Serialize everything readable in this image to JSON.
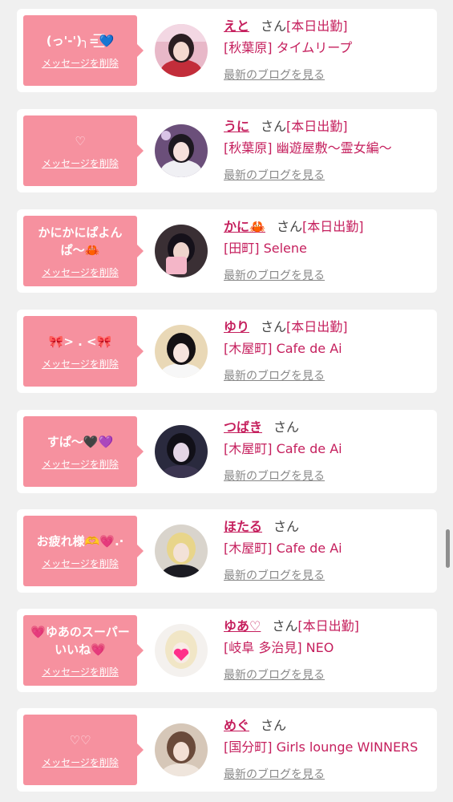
{
  "colors": {
    "accent": "#c51f5d",
    "bubble": "#f6919f"
  },
  "delete_label": "メッセージを削除",
  "san_label": "さん",
  "blog_label": "最新のブログを見る",
  "cards": [
    {
      "message": "(っ'-')╮=͟͟͞͞💙",
      "faint": false,
      "name": "えと",
      "status": "[本日出勤]",
      "shop": "[秋葉原] タイムリープ"
    },
    {
      "message": "♡",
      "faint": true,
      "name": "うに",
      "status": "[本日出勤]",
      "shop": "[秋葉原] 幽遊屋敷〜霊女編〜"
    },
    {
      "message": "かにかにぱよん\nぱ〜🦀",
      "faint": false,
      "name": "かに🦀",
      "status": "[本日出勤]",
      "shop": "[田町] Selene"
    },
    {
      "message": "🎀> . <🎀",
      "faint": false,
      "name": "ゆり",
      "status": "[本日出勤]",
      "shop": "[木屋町] Cafe de Ai"
    },
    {
      "message": "すぱ〜🖤💜",
      "faint": false,
      "name": "つばき",
      "status": "",
      "shop": "[木屋町] Cafe de Ai"
    },
    {
      "message": "お疲れ様🫶💗.·",
      "faint": false,
      "name": "ほたる",
      "status": "",
      "shop": "[木屋町] Cafe de Ai"
    },
    {
      "message": "💗ゆあのスーパー\nいいね💗",
      "faint": false,
      "name": "ゆあ♡",
      "status": "[本日出勤]",
      "shop": "[岐阜 多治見] NEO"
    },
    {
      "message": "♡♡",
      "faint": true,
      "name": "めぐ",
      "status": "",
      "shop": "[国分町] Girls lounge WINNERS"
    }
  ]
}
